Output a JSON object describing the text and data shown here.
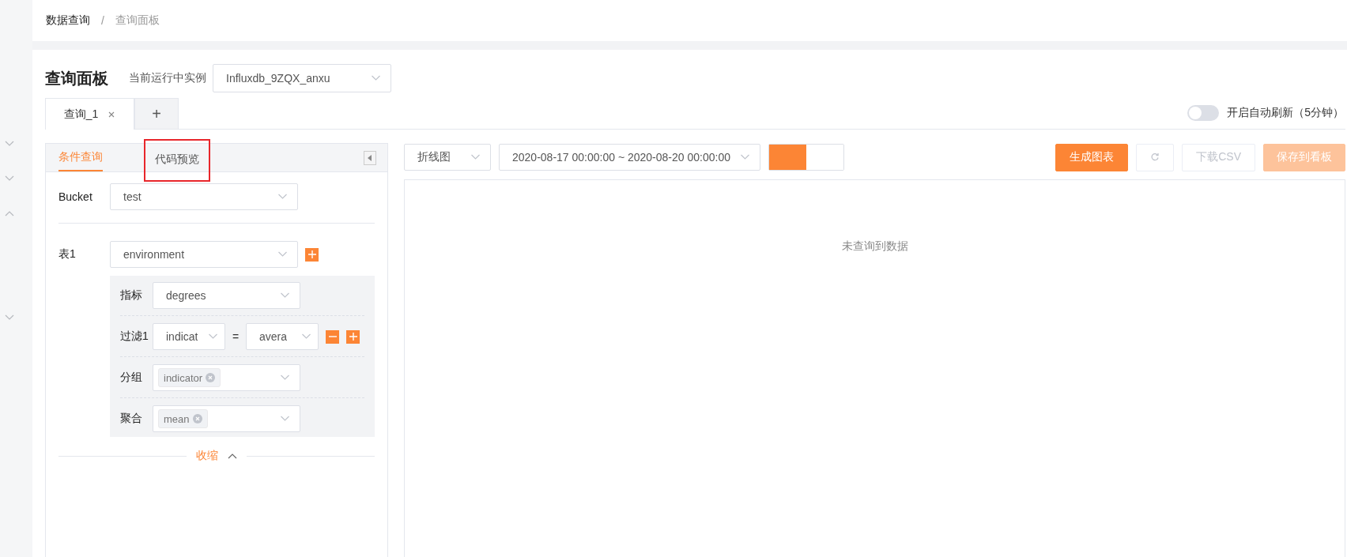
{
  "breadcrumb": [
    {
      "label": "数据查询",
      "current": false
    },
    {
      "label": "查询面板",
      "current": true
    }
  ],
  "breadcrumb_separator": "/",
  "page": {
    "title": "查询面板",
    "instance_label": "当前运行中实例",
    "instance_value": "Influxdb_9ZQX_anxu"
  },
  "query_tabs": [
    {
      "label": "查询_1",
      "selected": true,
      "closable": true
    }
  ],
  "add_tab": "+",
  "auto_refresh": {
    "on": false,
    "label": "开启自动刷新（5分钟）"
  },
  "left_panel": {
    "tabs": [
      {
        "label": "条件查询",
        "selected": true,
        "highlighted": false
      },
      {
        "label": "代码预览",
        "selected": false,
        "highlighted": true
      }
    ],
    "bucket": {
      "label": "Bucket",
      "value": "test"
    },
    "table": {
      "label": "表1",
      "value": "environment"
    },
    "rows": [
      {
        "kind": "select",
        "label": "指标",
        "value": "degrees"
      },
      {
        "kind": "filter",
        "label": "过滤1",
        "key": "indicat",
        "operator": "=",
        "value": "avera"
      },
      {
        "kind": "tags",
        "label": "分组",
        "tags": [
          "indicator"
        ]
      },
      {
        "kind": "tags",
        "label": "聚合",
        "tags": [
          "mean"
        ]
      }
    ],
    "collapse": "收缩"
  },
  "toolbar": {
    "chart_type": "折线图",
    "time_range": "2020-08-17 00:00:00 ~ 2020-08-20 00:00:00",
    "segments": [
      {
        "selected": true
      },
      {
        "selected": false
      }
    ],
    "buttons": [
      {
        "kind": "primary",
        "label": "生成图表",
        "disabled": false
      },
      {
        "kind": "icon",
        "disabled": true
      },
      {
        "kind": "default",
        "label": "下载CSV",
        "disabled": true
      },
      {
        "kind": "primary",
        "label": "保存到看板",
        "disabled": true
      }
    ]
  },
  "chart": {
    "empty_text": "未查询到数据"
  }
}
